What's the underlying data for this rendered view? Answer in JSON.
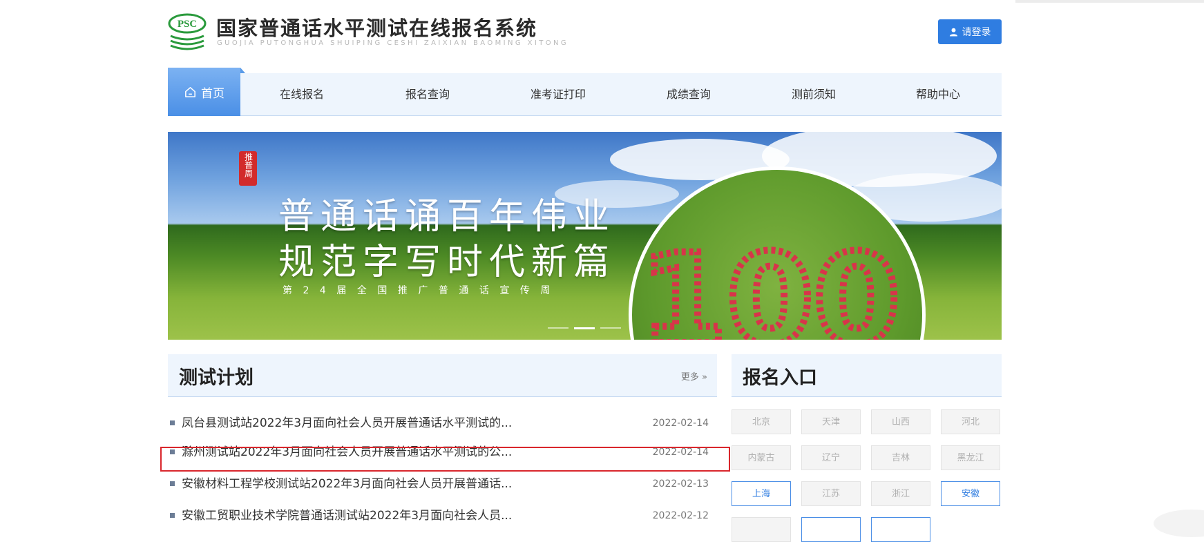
{
  "header": {
    "title": "国家普通话水平测试在线报名系统",
    "subtitle": "GUOJIA PUTONGHUA SHUIPING CESHI ZAIXIAN BAOMING XITONG",
    "logo_text": "PSC",
    "login_label": "请登录"
  },
  "nav": {
    "items": [
      "首页",
      "在线报名",
      "报名查询",
      "准考证打印",
      "成绩查询",
      "测前须知",
      "帮助中心"
    ],
    "active_index": 0
  },
  "banner": {
    "seal": "推普周",
    "line1": "普通话诵百年伟业",
    "line2": "规范字写时代新篇",
    "subline": "第24届全国推广普通话宣传周",
    "image_text": "100",
    "slide_count": 3,
    "active_slide": 1
  },
  "test_plan": {
    "title": "测试计划",
    "more_label": "更多",
    "items": [
      {
        "title": "凤台县测试站2022年3月面向社会人员开展普通话水平测试的...",
        "date": "2022-02-14"
      },
      {
        "title": "滁州测试站2022年3月面向社会人员开展普通话水平测试的公...",
        "date": "2022-02-14",
        "highlighted": true
      },
      {
        "title": "安徽材料工程学校测试站2022年3月面向社会人员开展普通话...",
        "date": "2022-02-13"
      },
      {
        "title": "安徽工贸职业技术学院普通话测试站2022年3月面向社会人员...",
        "date": "2022-02-12"
      }
    ]
  },
  "registration": {
    "title": "报名入口",
    "regions": [
      {
        "name": "北京",
        "active": false
      },
      {
        "name": "天津",
        "active": false
      },
      {
        "name": "山西",
        "active": false
      },
      {
        "name": "河北",
        "active": false
      },
      {
        "name": "内蒙古",
        "active": false
      },
      {
        "name": "辽宁",
        "active": false
      },
      {
        "name": "吉林",
        "active": false
      },
      {
        "name": "黑龙江",
        "active": false
      },
      {
        "name": "上海",
        "active": true
      },
      {
        "name": "江苏",
        "active": false
      },
      {
        "name": "浙江",
        "active": false
      },
      {
        "name": "安徽",
        "active": true
      }
    ]
  },
  "colors": {
    "primary": "#2f7de1",
    "nav_bg": "#eef5fd",
    "highlight_border": "#d9262c",
    "logo_green": "#2a9a3c"
  }
}
